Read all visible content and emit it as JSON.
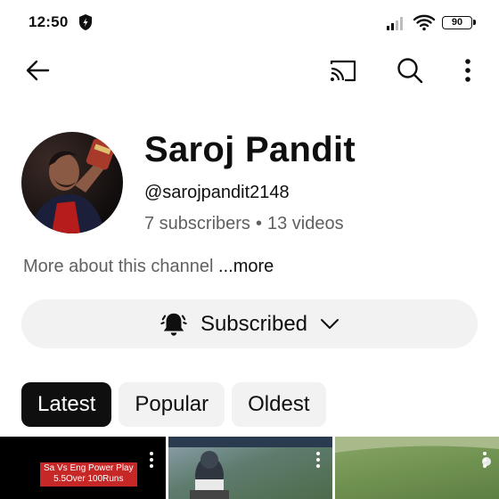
{
  "status_bar": {
    "time": "12:50",
    "battery": "90"
  },
  "app_bar": {
    "icons": [
      "back-arrow-icon",
      "cast-icon",
      "search-icon",
      "more-vert-icon"
    ]
  },
  "channel": {
    "name": "Saroj Pandit",
    "handle": "@sarojpandit2148",
    "subscribers": "7 subscribers",
    "separator": "•",
    "videos": "13 videos",
    "about_text": "More about this channel",
    "about_more": "...more"
  },
  "subscribe": {
    "label": "Subscribed"
  },
  "chips": [
    {
      "label": "Latest",
      "active": true
    },
    {
      "label": "Popular",
      "active": false
    },
    {
      "label": "Oldest",
      "active": false
    }
  ],
  "videos": [
    {
      "caption_line1": "Sa Vs Eng Power Play",
      "caption_line2": "5.5Over 100Runs"
    }
  ],
  "colors": {
    "text_primary": "#0f0f0f",
    "text_secondary": "#606060",
    "chip_bg": "#f2f2f2",
    "chip_active_bg": "#0f0f0f",
    "caption_bg": "#c62828"
  }
}
